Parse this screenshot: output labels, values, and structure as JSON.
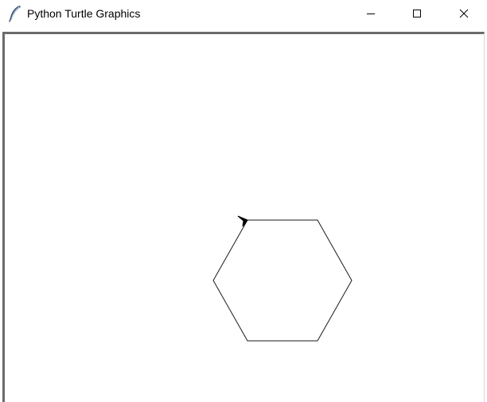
{
  "window": {
    "title": "Python Turtle Graphics",
    "app_icon": "feather-icon",
    "controls": {
      "minimize_icon": "minimize-icon",
      "maximize_icon": "maximize-icon",
      "close_icon": "close-icon"
    }
  },
  "canvas": {
    "background": "#ffffff",
    "pen_color": "#000000",
    "shape": "hexagon",
    "turtle_icon": "turtle-arrow-icon",
    "turtle_heading": "up-left"
  }
}
